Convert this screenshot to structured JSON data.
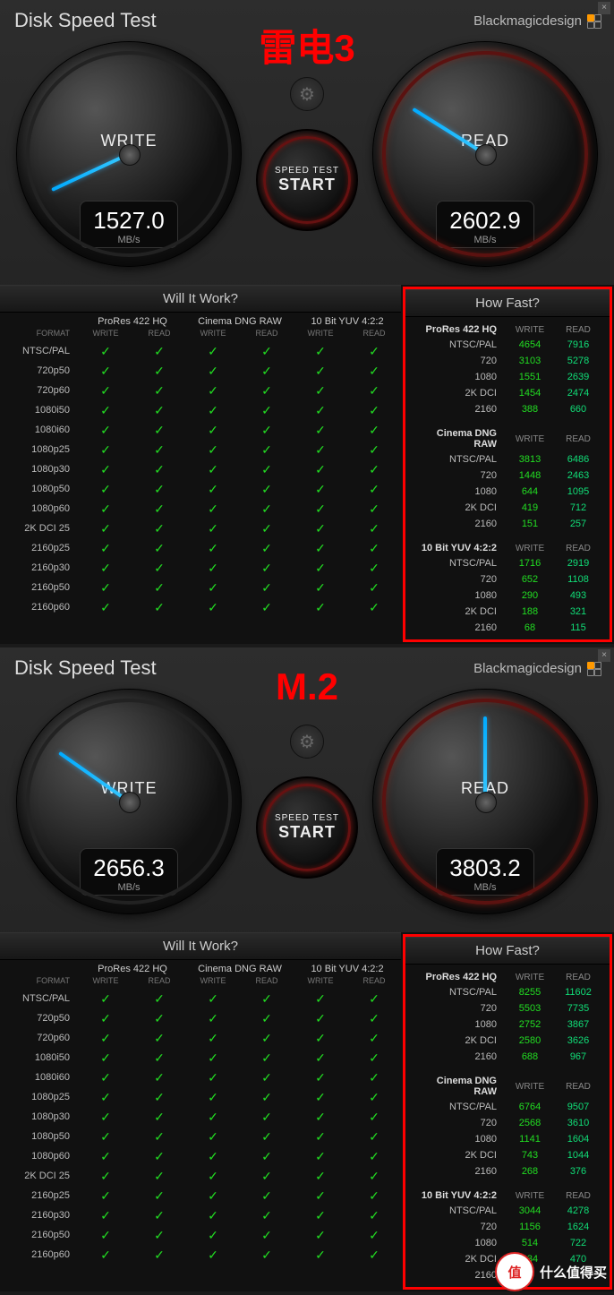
{
  "app": {
    "title": "Disk Speed Test",
    "brand": "Blackmagicdesign",
    "start_line1": "SPEED TEST",
    "start_line2": "START",
    "write_label": "WRITE",
    "read_label": "READ",
    "unit": "MB/s",
    "will_it_work": "Will It Work?",
    "how_fast": "How Fast?",
    "col_write": "WRITE",
    "col_read": "READ",
    "format_label": "FORMAT"
  },
  "codec_groups": [
    "ProRes 422 HQ",
    "Cinema DNG RAW",
    "10 Bit YUV 4:2:2"
  ],
  "formats": [
    "NTSC/PAL",
    "720p50",
    "720p60",
    "1080i50",
    "1080i60",
    "1080p25",
    "1080p30",
    "1080p50",
    "1080p60",
    "2K DCI 25",
    "2160p25",
    "2160p30",
    "2160p50",
    "2160p60"
  ],
  "hf_rows": [
    "NTSC/PAL",
    "720",
    "1080",
    "2K DCI",
    "2160"
  ],
  "tests": [
    {
      "overlay": "雷电3",
      "write_value": "1527.0",
      "read_value": "2602.9",
      "needle_write_deg": -115,
      "needle_read_deg": -58,
      "how_fast": {
        "ProRes 422 HQ": {
          "write": [
            4654,
            3103,
            1551,
            1454,
            388
          ],
          "read": [
            7916,
            5278,
            2639,
            2474,
            660
          ]
        },
        "Cinema DNG RAW": {
          "write": [
            3813,
            1448,
            644,
            419,
            151
          ],
          "read": [
            6486,
            2463,
            1095,
            712,
            257
          ]
        },
        "10 Bit YUV 4:2:2": {
          "write": [
            1716,
            652,
            290,
            188,
            68
          ],
          "read": [
            2919,
            1108,
            493,
            321,
            115
          ]
        }
      }
    },
    {
      "overlay": "M.2",
      "write_value": "2656.3",
      "read_value": "3803.2",
      "needle_write_deg": -55,
      "needle_read_deg": 0,
      "how_fast": {
        "ProRes 422 HQ": {
          "write": [
            8255,
            5503,
            2752,
            2580,
            688
          ],
          "read": [
            11602,
            7735,
            3867,
            3626,
            967
          ]
        },
        "Cinema DNG RAW": {
          "write": [
            6764,
            2568,
            1141,
            743,
            268
          ],
          "read": [
            9507,
            3610,
            1604,
            1044,
            376
          ]
        },
        "10 Bit YUV 4:2:2": {
          "write": [
            3044,
            1156,
            514,
            334,
            null
          ],
          "read": [
            4278,
            1624,
            722,
            470,
            null
          ]
        }
      }
    }
  ],
  "watermark": {
    "badge": "值",
    "text": "什么值得买"
  }
}
